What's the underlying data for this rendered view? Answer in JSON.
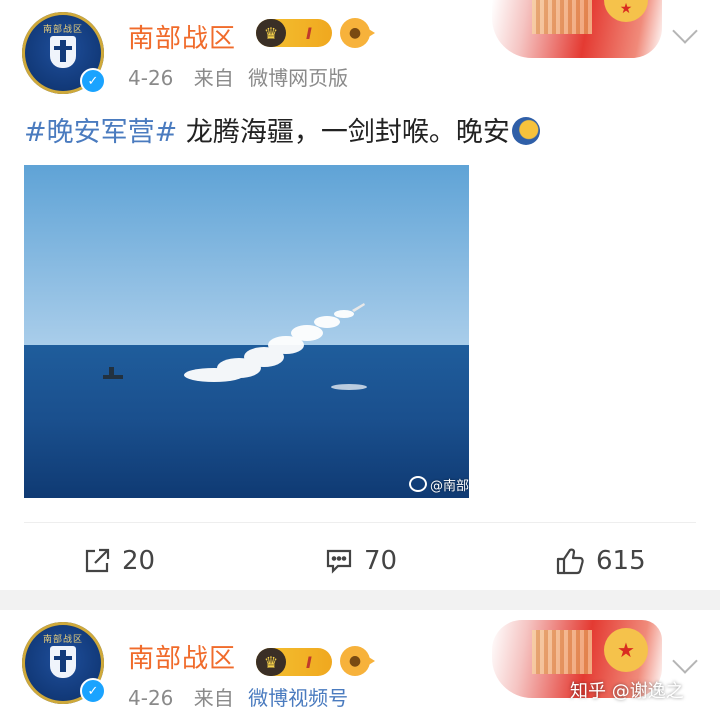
{
  "post1": {
    "author": "南部战区",
    "avatar_ring_text": "南部战区",
    "vip_level": "I",
    "time": "4-26",
    "source_prefix": "来自",
    "source": "微博网页版",
    "topic": "#晚安军营#",
    "text": " 龙腾海疆，一剑封喉。晚安",
    "photo_watermark": "@南部",
    "actions": {
      "share_count": "20",
      "comment_count": "70",
      "like_count": "615"
    }
  },
  "post2": {
    "author": "南部战区",
    "avatar_ring_text": "南部战区",
    "vip_level": "I",
    "time": "4-26",
    "source_prefix": "来自",
    "source": "微博视频号"
  },
  "page_watermark": "知乎 @谢逸之",
  "colors": {
    "author_name": "#f06b2b",
    "topic_link": "#4a7bbf",
    "source_link": "#4a7bbf",
    "meta_gray": "#8a8a8a",
    "verified_badge": "#1aa3ff",
    "vip_gold": "#f4c232"
  },
  "icons": {
    "share": "share-icon",
    "comment": "comment-icon",
    "like": "thumbs-up-icon",
    "more": "chevron-down-icon"
  }
}
